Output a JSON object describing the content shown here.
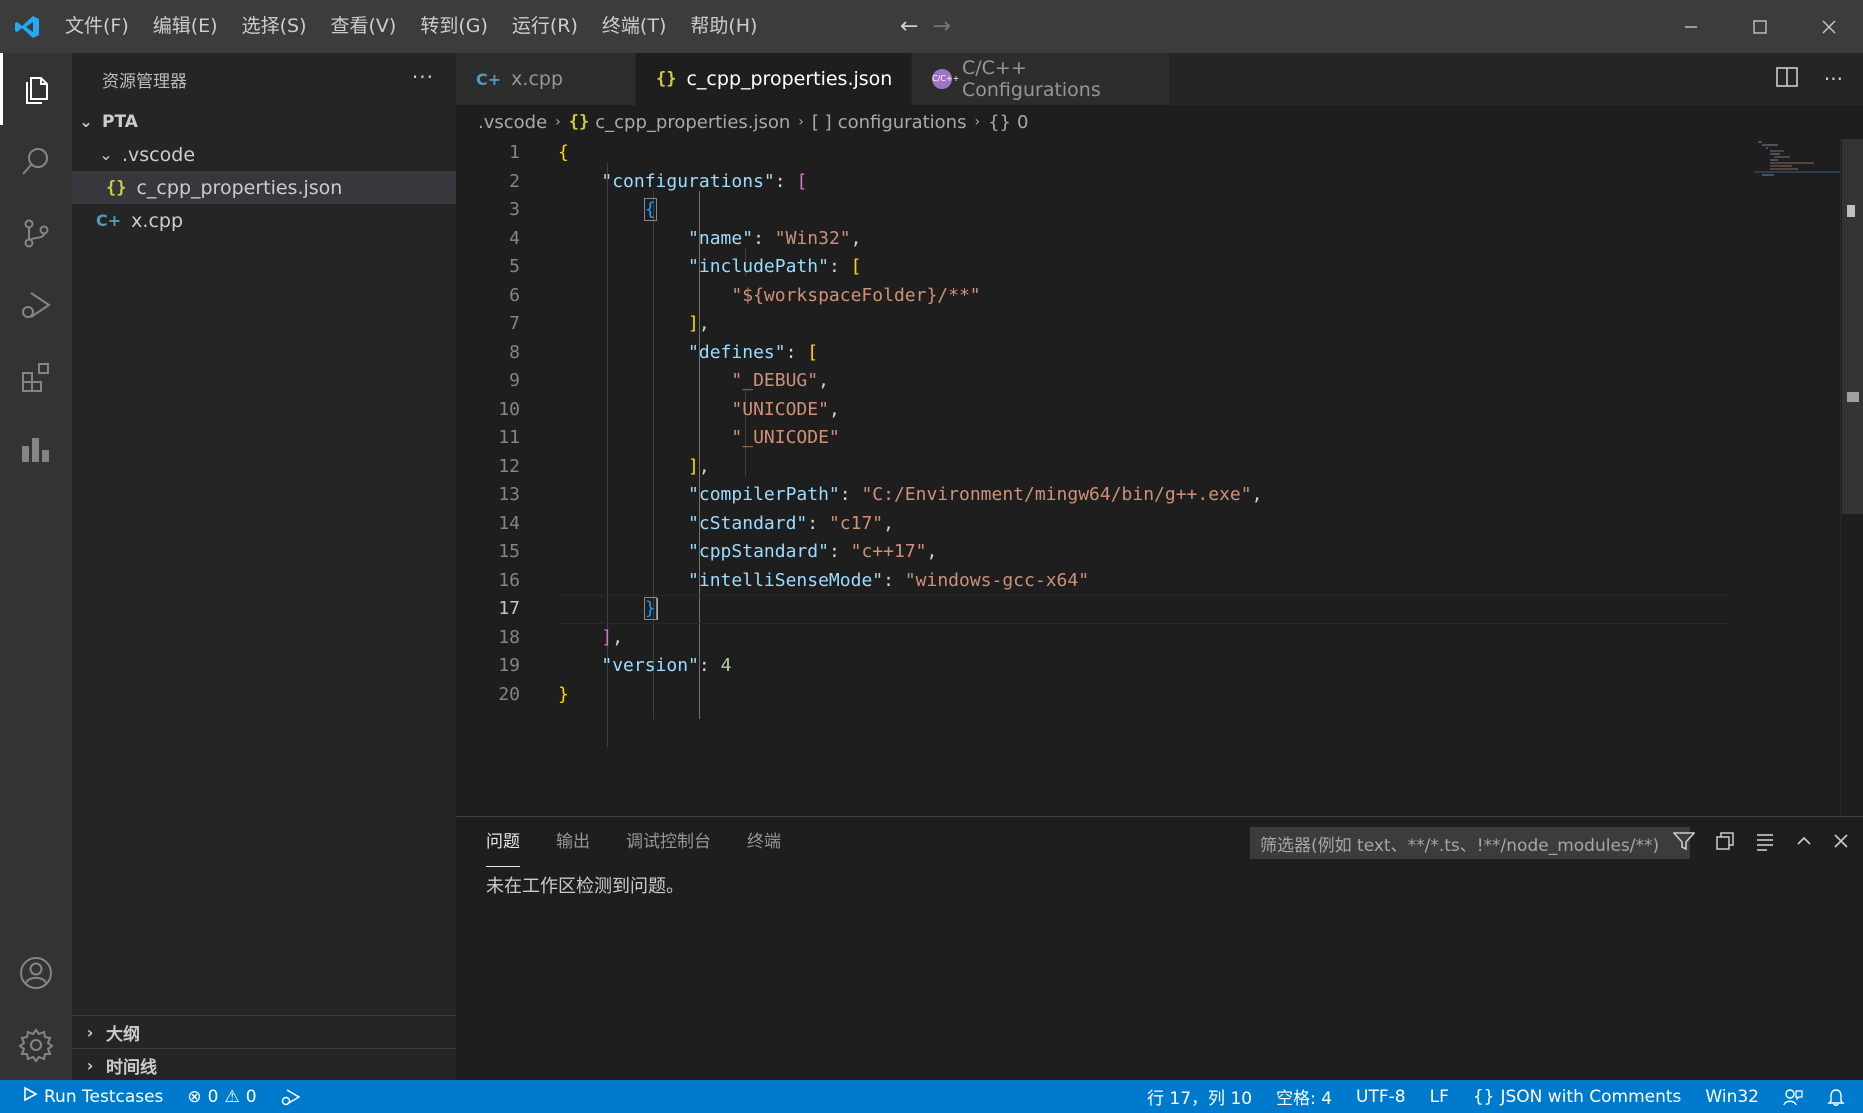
{
  "menu": [
    "文件(F)",
    "编辑(E)",
    "选择(S)",
    "查看(V)",
    "转到(G)",
    "运行(R)",
    "终端(T)",
    "帮助(H)"
  ],
  "sidebar": {
    "title": "资源管理器",
    "root": "PTA",
    "folder": ".vscode",
    "files": {
      "json": "c_cpp_properties.json",
      "cpp": "x.cpp"
    },
    "sections": [
      "大纲",
      "时间线"
    ]
  },
  "tabs": [
    {
      "label": "x.cpp",
      "icon": "cpp-icon"
    },
    {
      "label": "c_cpp_properties.json",
      "icon": "json-icon",
      "active": true
    },
    {
      "label": "C/C++ Configurations",
      "icon": "cpp-config-icon"
    }
  ],
  "breadcrumb": [
    ".vscode",
    "c_cpp_properties.json",
    "configurations",
    "0"
  ],
  "editor": {
    "lines": [
      "1",
      "2",
      "3",
      "4",
      "5",
      "6",
      "7",
      "8",
      "9",
      "10",
      "11",
      "12",
      "13",
      "14",
      "15",
      "16",
      "17",
      "18",
      "19",
      "20"
    ],
    "current_line": 17,
    "tokens": {
      "configurations": "\"configurations\"",
      "name": "\"name\"",
      "name_val": "\"Win32\"",
      "includePath": "\"includePath\"",
      "includePath_val": "\"${workspaceFolder}/**\"",
      "defines": "\"defines\"",
      "def1": "\"_DEBUG\"",
      "def2": "\"UNICODE\"",
      "def3": "\"_UNICODE\"",
      "compilerPath": "\"compilerPath\"",
      "compilerPath_val": "\"C:/Environment/mingw64/bin/g++.exe\"",
      "cStandard": "\"cStandard\"",
      "cStandard_val": "\"c17\"",
      "cppStandard": "\"cppStandard\"",
      "cppStandard_val": "\"c++17\"",
      "intelliSenseMode": "\"intelliSenseMode\"",
      "intelliSenseMode_val": "\"windows-gcc-x64\"",
      "version": "\"version\"",
      "version_val": "4"
    }
  },
  "panel": {
    "tabs": [
      "问题",
      "输出",
      "调试控制台",
      "终端"
    ],
    "filter_placeholder": "筛选器(例如 text、**/*.ts、!**/node_modules/**)",
    "message": "未在工作区检测到问题。"
  },
  "statusbar": {
    "run": "Run Testcases",
    "errors": "0",
    "warnings": "0",
    "position": "行 17，列 10",
    "spaces": "空格: 4",
    "encoding": "UTF-8",
    "eol": "LF",
    "language": "JSON with Comments",
    "config": "Win32"
  },
  "colors": {
    "accent": "#007acc",
    "titlebar": "#3c3c3c",
    "activitybar": "#333333",
    "sidebar": "#252526",
    "editor": "#1e1e1e"
  }
}
